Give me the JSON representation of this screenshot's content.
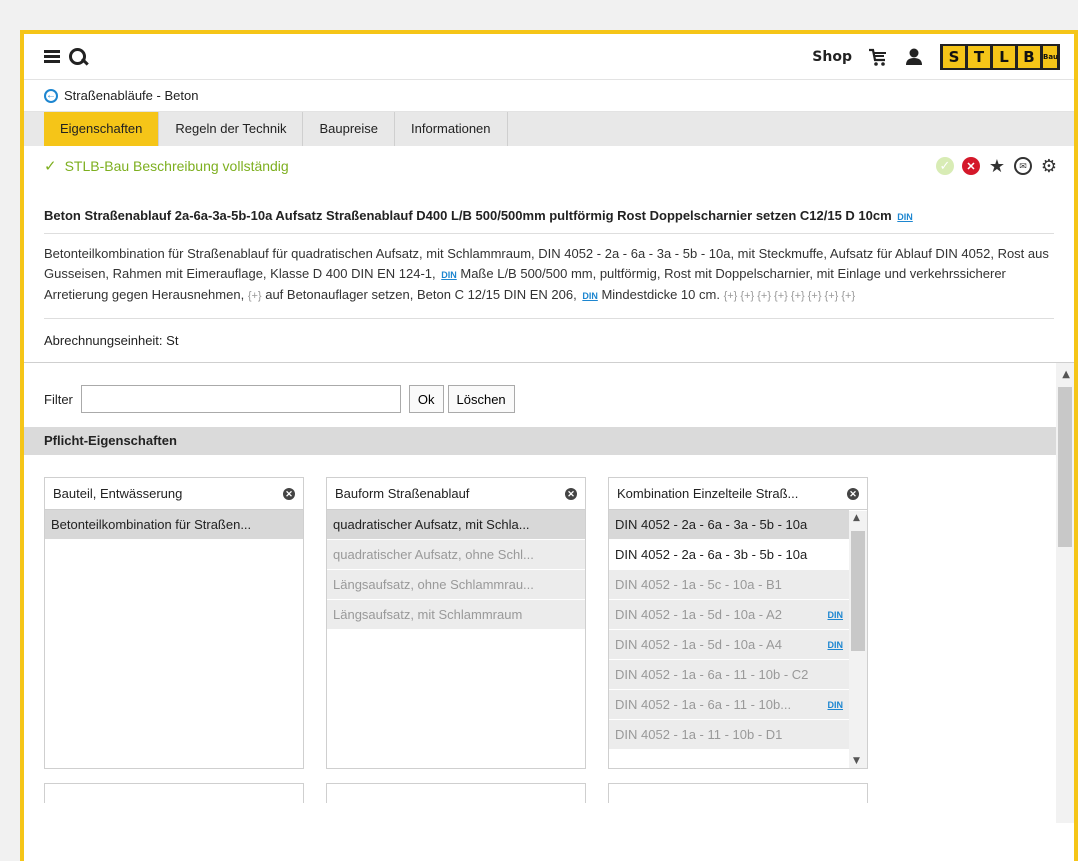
{
  "header": {
    "shop_label": "Shop",
    "logo_letters": [
      "S",
      "T",
      "L",
      "B",
      "Bau"
    ],
    "icons": [
      "menu-icon",
      "search-icon",
      "cart-icon",
      "user-icon"
    ]
  },
  "breadcrumb": {
    "label": "Straßenabläufe - Beton"
  },
  "tabs": [
    {
      "label": "Eigenschaften",
      "active": true
    },
    {
      "label": "Regeln der Technik",
      "active": false
    },
    {
      "label": "Baupreise",
      "active": false
    },
    {
      "label": "Informationen",
      "active": false
    }
  ],
  "status": {
    "text": "STLB-Bau Beschreibung vollständig",
    "color": "#7daf1f"
  },
  "item": {
    "title": "Beton Straßenablauf 2a-6a-3a-5b-10a Aufsatz Straßenablauf D400 L/B 500/500mm pultförmig Rost Doppelscharnier setzen C12/15 D 10cm",
    "din_label": "DIN",
    "desc_1": "Betonteilkombination für Straßenablauf für quadratischen Aufsatz, mit Schlammraum, DIN 4052 - 2a - 6a - 3a - 5b - 10a, mit Steckmuffe, Aufsatz für Ablauf DIN 4052, Rost aus Gusseisen, Rahmen mit Eimerauflage, Klasse D 400 DIN EN 124-1,",
    "desc_2": "Maße L/B 500/500 mm, pultförmig, Rost mit Doppelscharnier, mit Einlage und verkehrssicherer Arretierung gegen Herausnehmen,",
    "desc_plus": "{+}",
    "desc_3": "auf Betonauflager setzen, Beton C 12/15 DIN EN 206,",
    "desc_4": "Mindestdicke 10 cm.",
    "desc_tail_plus": "{+} {+} {+} {+} {+} {+} {+} {+}",
    "unit": "Abrechnungseinheit: St"
  },
  "filter": {
    "label": "Filter",
    "value": "",
    "placeholder": "",
    "ok_label": "Ok",
    "clear_label": "Löschen"
  },
  "section": {
    "title": "Pflicht-Eigenschaften"
  },
  "boxes": [
    {
      "title": "Bauteil, Entwässerung",
      "options": [
        {
          "label": "Betonteilkombination für Straßen...",
          "state": "sel"
        }
      ]
    },
    {
      "title": "Bauform Straßenablauf",
      "options": [
        {
          "label": "quadratischer Aufsatz, mit Schla...",
          "state": "sel"
        },
        {
          "label": "quadratischer Aufsatz, ohne Schl...",
          "state": "dim"
        },
        {
          "label": "Längsaufsatz, ohne Schlammrau...",
          "state": "dim"
        },
        {
          "label": "Längsaufsatz, mit Schlammraum",
          "state": "dim"
        }
      ]
    },
    {
      "title": "Kombination Einzelteile Straß...",
      "options": [
        {
          "label": "DIN 4052 - 2a - 6a - 3a - 5b - 10a",
          "state": "sel",
          "din": ""
        },
        {
          "label": "DIN 4052 - 2a - 6a - 3b - 5b - 10a",
          "state": "avail",
          "din": ""
        },
        {
          "label": "DIN 4052 - 1a - 5c - 10a - B1",
          "state": "dim",
          "din": ""
        },
        {
          "label": "DIN 4052 - 1a - 5d - 10a - A2",
          "state": "dim",
          "din": "DIN"
        },
        {
          "label": "DIN 4052 - 1a - 5d - 10a - A4",
          "state": "dim",
          "din": "DIN"
        },
        {
          "label": "DIN 4052 - 1a - 6a - 11 - 10b - C2",
          "state": "dim",
          "din": ""
        },
        {
          "label": "DIN 4052 - 1a - 6a - 11 - 10b...",
          "state": "dim",
          "din": "DIN"
        },
        {
          "label": "DIN 4052 - 1a - 11 - 10b - D1",
          "state": "dim",
          "din": ""
        }
      ]
    }
  ],
  "colors": {
    "accent": "#f5c518",
    "link": "#1d86d0",
    "error": "#d4182a"
  }
}
